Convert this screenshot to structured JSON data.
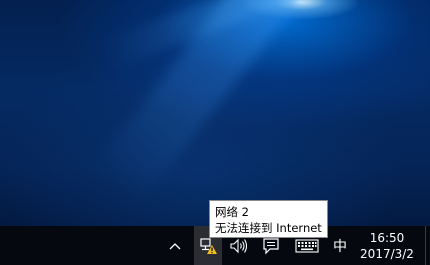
{
  "tooltip": {
    "title": "网络  2",
    "status": "无法连接到 Internet"
  },
  "tray": {
    "chevron_icon": "chevron-up-icon",
    "network_icon": "network-warning-icon",
    "volume_icon": "volume-icon",
    "action_center_icon": "action-center-icon",
    "keyboard_icon": "touch-keyboard-icon",
    "ime_label": "中"
  },
  "clock": {
    "time": "16:50",
    "date": "2017/3/2"
  },
  "colors": {
    "taskbar": "#06080f",
    "warning": "#f0c020"
  }
}
